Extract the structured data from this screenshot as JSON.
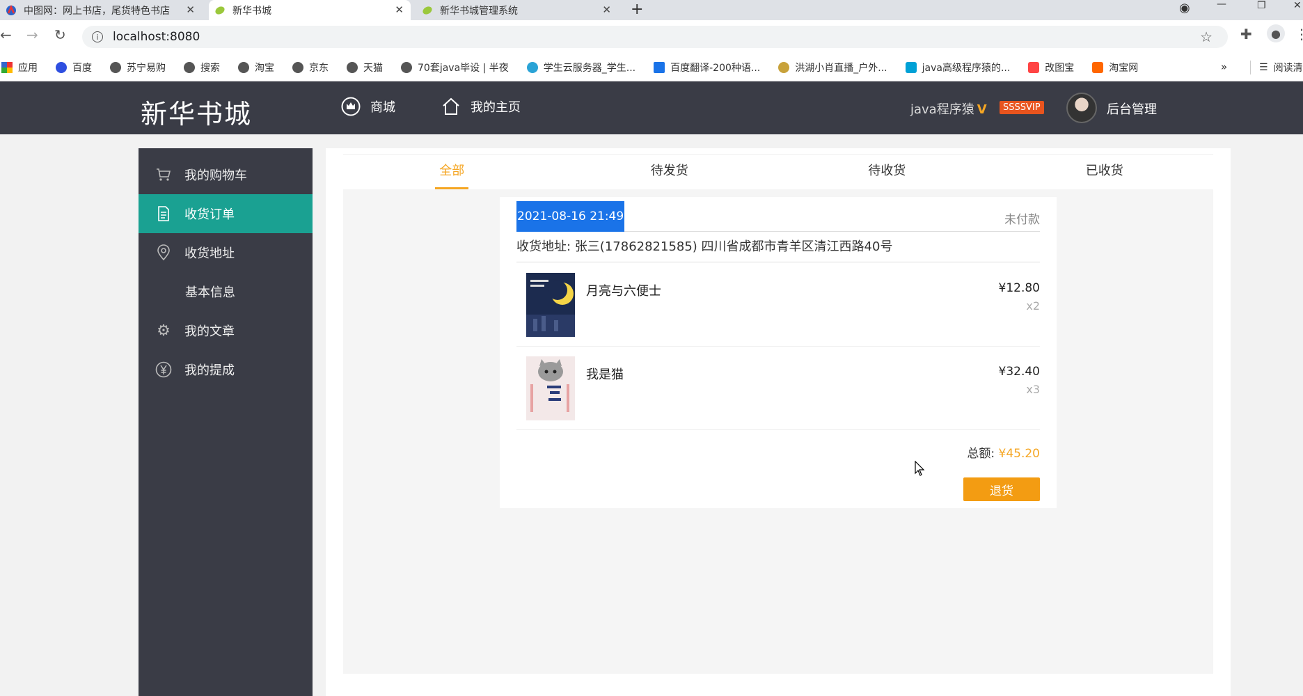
{
  "browser": {
    "tabs": [
      {
        "title": "中图网：网上书店，尾货特色书店",
        "active": false
      },
      {
        "title": "新华书城",
        "active": true
      },
      {
        "title": "新华书城管理系统",
        "active": false
      }
    ],
    "new_tab": "+",
    "url": "localhost:8080",
    "bookmarks": [
      "应用",
      "百度",
      "苏宁易购",
      "搜索",
      "淘宝",
      "京东",
      "天猫",
      "70套java毕设 | 半夜",
      "学生云服务器_学生...",
      "百度翻译-200种语...",
      "洪湖小肖直播_户外...",
      "java高级程序猿的...",
      "改图宝",
      "淘宝网"
    ],
    "bookmarks_more": "»",
    "reading_list": "阅读清单"
  },
  "header": {
    "logo": "新华书城",
    "nav": [
      {
        "label": "商城",
        "icon": "crown-icon"
      },
      {
        "label": "我的主页",
        "icon": "home-icon"
      }
    ],
    "username": "java程序猿",
    "v_mark": "V",
    "vip_badge": "SSSSVIP",
    "admin_link": "后台管理"
  },
  "sidebar": {
    "items": [
      {
        "label": "我的购物车",
        "icon": "cart-icon",
        "active": false
      },
      {
        "label": "收货订单",
        "icon": "document-icon",
        "active": true
      },
      {
        "label": "收货地址",
        "icon": "location-pin-icon",
        "active": false
      },
      {
        "label": "基本信息",
        "icon": "",
        "active": false
      },
      {
        "label": "我的文章",
        "icon": "gear-icon",
        "active": false
      },
      {
        "label": "我的提成",
        "icon": "yen-icon",
        "active": false
      }
    ]
  },
  "order_tabs": [
    {
      "label": "全部",
      "active": true
    },
    {
      "label": "待发货",
      "active": false
    },
    {
      "label": "待收货",
      "active": false
    },
    {
      "label": "已收货",
      "active": false
    }
  ],
  "order": {
    "date": "2021-08-16 21:49",
    "status": "未付款",
    "address_label": "收货地址:",
    "address": "张三(17862821585) 四川省成都市青羊区清江西路40号",
    "items": [
      {
        "name": "月亮与六便士",
        "price": "¥12.80",
        "qty": "x2"
      },
      {
        "name": "我是猫",
        "price": "¥32.40",
        "qty": "x3"
      }
    ],
    "total_label": "总额:",
    "total": "¥45.20",
    "refund_label": "退货"
  },
  "colors": {
    "header_bg": "#3a3c46",
    "sidebar_active": "#1aa192",
    "accent": "#f5a623",
    "refund_button": "#f39c12"
  }
}
